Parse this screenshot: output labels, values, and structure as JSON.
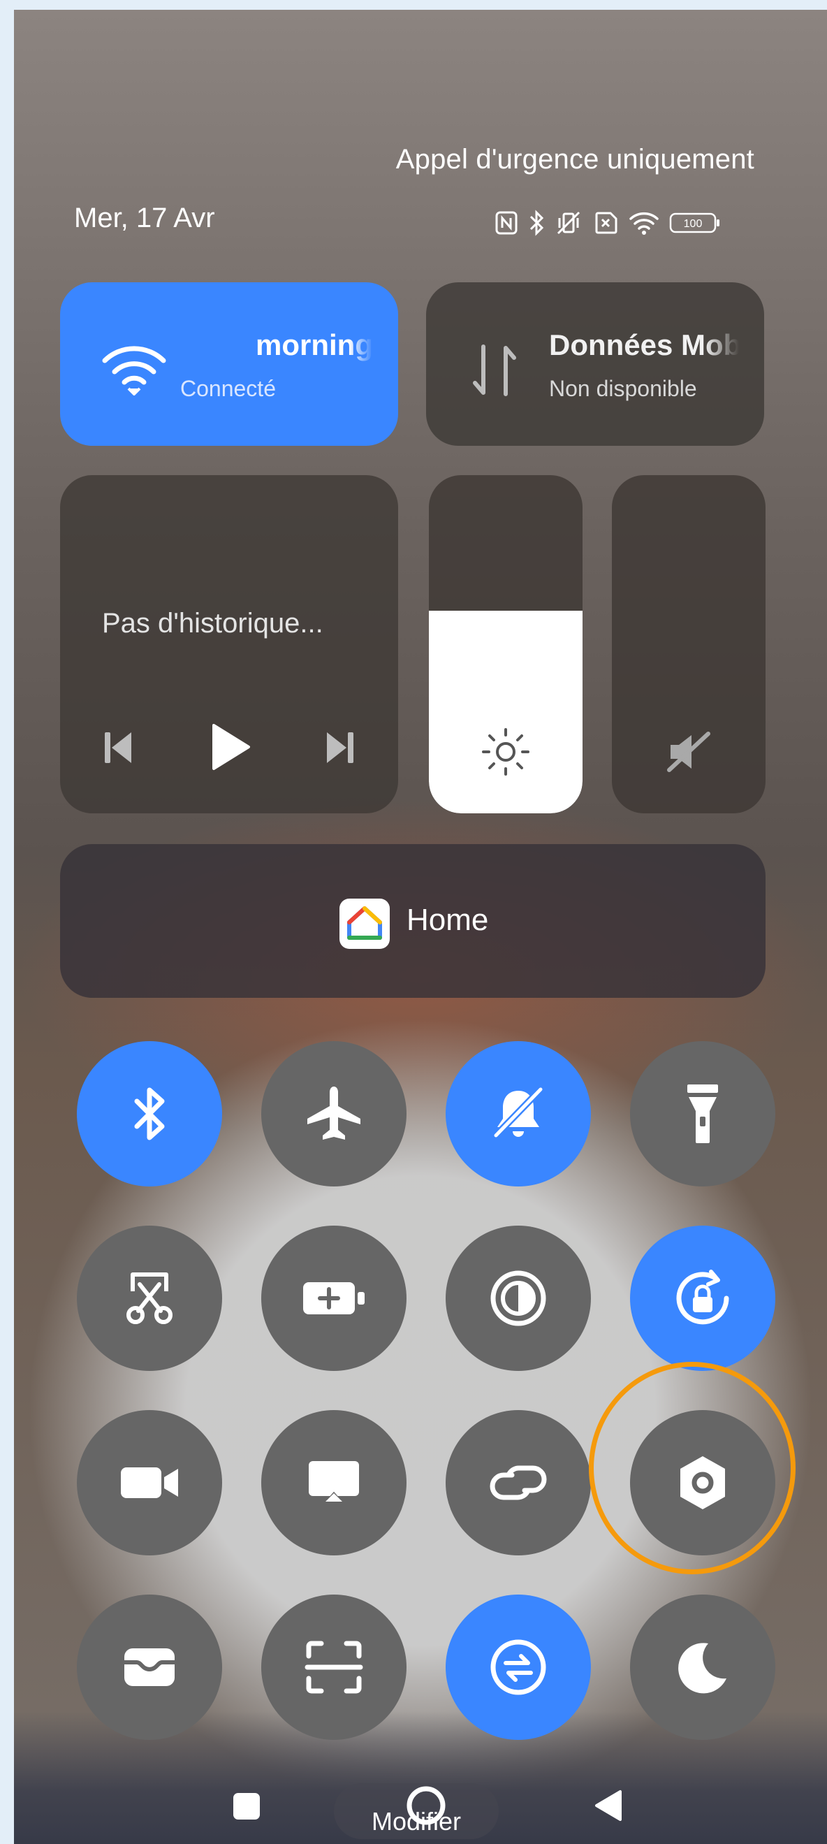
{
  "status_bar": {
    "emergency_text": "Appel d'urgence uniquement",
    "date": "Mer, 17 Avr",
    "icons": [
      "nfc-icon",
      "bluetooth-icon",
      "vibrate-off-icon",
      "no-sim-icon",
      "wifi-icon",
      "battery-icon"
    ],
    "battery_level": "100"
  },
  "wifi_card": {
    "title": "morning",
    "status": "Connecté",
    "icon": "wifi-icon",
    "active": true
  },
  "data_card": {
    "title": "Données Mobiles",
    "status": "Non disponible",
    "icon": "mobile-data-arrows-icon"
  },
  "media_card": {
    "title": "Pas d'historique...",
    "controls": [
      "previous-track-icon",
      "play-icon",
      "next-track-icon"
    ]
  },
  "brightness_slider": {
    "level": 0.6,
    "icon": "sun-icon"
  },
  "volume_slider": {
    "level": 0,
    "icon": "volume-muted-icon"
  },
  "home_card": {
    "label": "Home",
    "icon": "google-home-icon"
  },
  "toggle_tiles": [
    {
      "icon": "bluetooth-icon",
      "active": true
    },
    {
      "icon": "airplane-icon",
      "active": false
    },
    {
      "icon": "bell-mute-icon",
      "active": true
    },
    {
      "icon": "flashlight-icon",
      "active": false
    },
    {
      "icon": "screenshot-scissors-icon",
      "active": false
    },
    {
      "icon": "battery-saver-icon",
      "active": false
    },
    {
      "icon": "contrast-icon",
      "active": false
    },
    {
      "icon": "rotation-lock-icon",
      "active": true
    },
    {
      "icon": "screen-record-icon",
      "active": false
    },
    {
      "icon": "cast-icon",
      "active": false
    },
    {
      "icon": "link-icon",
      "active": false
    },
    {
      "icon": "hexagon-settings-icon",
      "active": false
    },
    {
      "icon": "wallet-icon",
      "active": false
    },
    {
      "icon": "scan-icon",
      "active": false
    },
    {
      "icon": "sync-icon",
      "active": true
    },
    {
      "icon": "moon-icon",
      "active": false
    }
  ],
  "highlight": {
    "target_icon": "hexagon-settings-icon",
    "color": "#f59a0c"
  },
  "colors": {
    "accent": "#3a86ff",
    "tile_inactive": "#666666"
  },
  "nav_bar": {
    "edit_label": "Modifier",
    "buttons": [
      "recents-square-icon",
      "home-circle-icon",
      "back-triangle-icon"
    ]
  }
}
